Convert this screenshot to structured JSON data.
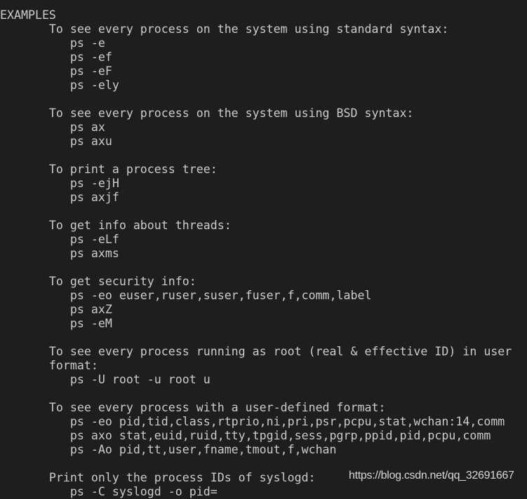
{
  "terminal": {
    "lines": [
      "EXAMPLES",
      "       To see every process on the system using standard syntax:",
      "          ps -e",
      "          ps -ef",
      "          ps -eF",
      "          ps -ely",
      "",
      "       To see every process on the system using BSD syntax:",
      "          ps ax",
      "          ps axu",
      "",
      "       To print a process tree:",
      "          ps -ejH",
      "          ps axjf",
      "",
      "       To get info about threads:",
      "          ps -eLf",
      "          ps axms",
      "",
      "       To get security info:",
      "          ps -eo euser,ruser,suser,fuser,f,comm,label",
      "          ps axZ",
      "          ps -eM",
      "",
      "       To see every process running as root (real & effective ID) in user",
      "       format:",
      "          ps -U root -u root u",
      "",
      "       To see every process with a user-defined format:",
      "          ps -eo pid,tid,class,rtprio,ni,pri,psr,pcpu,stat,wchan:14,comm",
      "          ps axo stat,euid,ruid,tty,tpgid,sess,pgrp,ppid,pid,pcpu,comm",
      "          ps -Ao pid,tt,user,fname,tmout,f,wchan",
      "",
      "       Print only the process IDs of syslogd:",
      "          ps -C syslogd -o pid="
    ]
  },
  "watermark": "https://blog.csdn.net/qq_32691667"
}
